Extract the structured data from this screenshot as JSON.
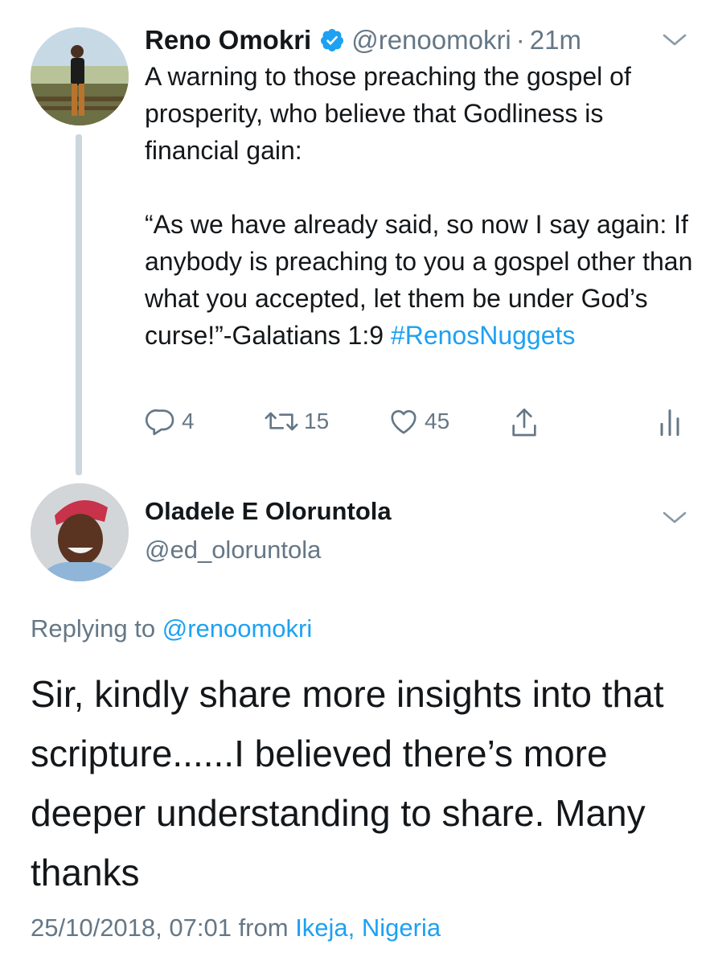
{
  "tweet": {
    "author_name": "Reno Omokri",
    "author_handle": "@renoomokri",
    "separator": "·",
    "time": "21m",
    "paragraph1": "A warning to those preaching the gospel of prosperity, who believe that Godliness is financial gain:",
    "paragraph2_text": "“As we have already said, so now I say again: If anybody is preaching to you a gospel other than what you accepted, let them be under God’s curse!”-Galatians 1:9 ",
    "hashtag": "#RenosNuggets",
    "actions": {
      "reply_count": "4",
      "retweet_count": "15",
      "like_count": "45"
    },
    "icons": [
      "avatar",
      "verified-badge-icon",
      "chevron-down-icon",
      "reply-icon",
      "retweet-icon",
      "like-icon",
      "share-icon",
      "analytics-icon"
    ]
  },
  "reply": {
    "author_name": "Oladele E Oloruntola",
    "author_handle": "@ed_oloruntola",
    "replying_prefix": "Replying to ",
    "replying_mention": "@renoomokri",
    "text": "Sir, kindly share more insights into that scripture......I believed there’s more deeper understanding to share. Many thanks",
    "timestamp": "25/10/2018, 07:01 from ",
    "location": "Ikeja, Nigeria"
  },
  "colors": {
    "text": "#14171a",
    "secondary": "#657786",
    "accent": "#1da1f2",
    "thread_line": "#ccd6dd"
  }
}
